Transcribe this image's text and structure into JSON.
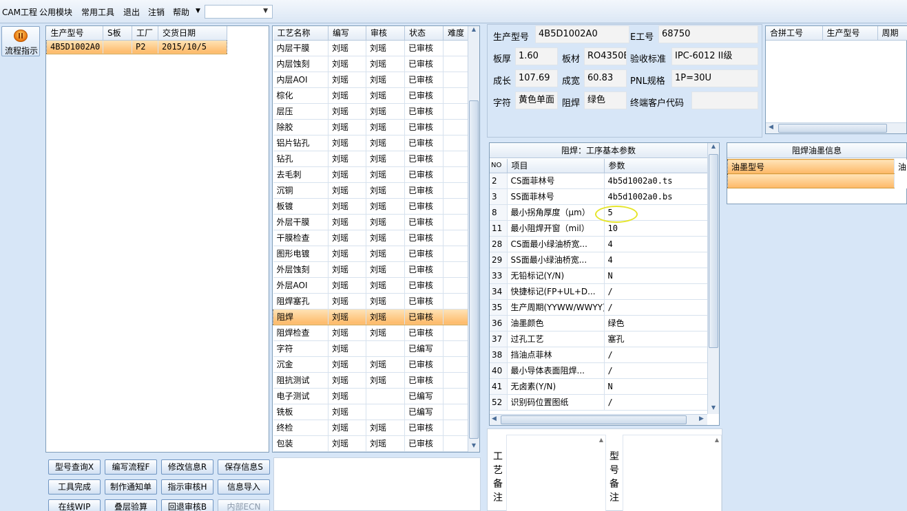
{
  "menu": {
    "items": [
      "CAM工程",
      "公用模块",
      "常用工具",
      "退出",
      "注销",
      "帮助"
    ],
    "dropdown_value": ""
  },
  "sidebar": {
    "flow_label": "流程指示"
  },
  "order_table": {
    "headers": [
      "生产型号",
      "S板",
      "工厂",
      "交货日期"
    ],
    "rows": [
      [
        "4B5D1002A0",
        "",
        "P2",
        "2015/10/5"
      ]
    ]
  },
  "process_table": {
    "headers": [
      "工艺名称",
      "编写",
      "审核",
      "状态",
      "难度"
    ],
    "selected_index": 17,
    "rows": [
      [
        "内层干膜",
        "刘瑶",
        "刘瑶",
        "已审核",
        ""
      ],
      [
        "内层蚀刻",
        "刘瑶",
        "刘瑶",
        "已审核",
        ""
      ],
      [
        "内层AOI",
        "刘瑶",
        "刘瑶",
        "已审核",
        ""
      ],
      [
        "棕化",
        "刘瑶",
        "刘瑶",
        "已审核",
        ""
      ],
      [
        "层压",
        "刘瑶",
        "刘瑶",
        "已审核",
        ""
      ],
      [
        "除胶",
        "刘瑶",
        "刘瑶",
        "已审核",
        ""
      ],
      [
        "铝片钻孔",
        "刘瑶",
        "刘瑶",
        "已审核",
        ""
      ],
      [
        "钻孔",
        "刘瑶",
        "刘瑶",
        "已审核",
        ""
      ],
      [
        "去毛刺",
        "刘瑶",
        "刘瑶",
        "已审核",
        ""
      ],
      [
        "沉铜",
        "刘瑶",
        "刘瑶",
        "已审核",
        ""
      ],
      [
        "板镀",
        "刘瑶",
        "刘瑶",
        "已审核",
        ""
      ],
      [
        "外层干膜",
        "刘瑶",
        "刘瑶",
        "已审核",
        ""
      ],
      [
        "干膜检查",
        "刘瑶",
        "刘瑶",
        "已审核",
        ""
      ],
      [
        "图形电镀",
        "刘瑶",
        "刘瑶",
        "已审核",
        ""
      ],
      [
        "外层蚀刻",
        "刘瑶",
        "刘瑶",
        "已审核",
        ""
      ],
      [
        "外层AOI",
        "刘瑶",
        "刘瑶",
        "已审核",
        ""
      ],
      [
        "阻焊塞孔",
        "刘瑶",
        "刘瑶",
        "已审核",
        ""
      ],
      [
        "阻焊",
        "刘瑶",
        "刘瑶",
        "已审核",
        ""
      ],
      [
        "阻焊检查",
        "刘瑶",
        "刘瑶",
        "已审核",
        ""
      ],
      [
        "字符",
        "刘瑶",
        "",
        "已编写",
        ""
      ],
      [
        "沉金",
        "刘瑶",
        "刘瑶",
        "已审核",
        ""
      ],
      [
        "阻抗测试",
        "刘瑶",
        "刘瑶",
        "已审核",
        ""
      ],
      [
        "电子测试",
        "刘瑶",
        "",
        "已编写",
        ""
      ],
      [
        "铣板",
        "刘瑶",
        "",
        "已编写",
        ""
      ],
      [
        "终检",
        "刘瑶",
        "刘瑶",
        "已审核",
        ""
      ],
      [
        "包装",
        "刘瑶",
        "刘瑶",
        "已审核",
        ""
      ]
    ]
  },
  "buttons": [
    [
      "型号查询X",
      "编写流程F",
      "修改信息R",
      "保存信息S"
    ],
    [
      "工具完成",
      "制作通知单",
      "指示审核H",
      "信息导入"
    ],
    [
      "在线WIP",
      "叠层验算",
      "回退审核B",
      "内部ECN"
    ]
  ],
  "info": {
    "labels": {
      "model": "生产型号",
      "e_no": "E工号",
      "thickness": "板厚",
      "material": "板材",
      "standard": "验收标准",
      "length": "成长",
      "width": "成宽",
      "pnl": "PNL规格",
      "silk": "字符",
      "mask": "阻焊",
      "customer": "终端客户代码"
    },
    "values": {
      "model": "4B5D1002A0",
      "e_no": "68750",
      "thickness": "1.60",
      "material": "RO4350B",
      "standard": "IPC-6012 II级",
      "length": "107.69",
      "width": "60.83",
      "pnl": "1P=30U",
      "silk": "黄色单面",
      "mask": "绿色",
      "customer": ""
    }
  },
  "merge_table": {
    "headers": [
      "合拼工号",
      "生产型号",
      "周期"
    ]
  },
  "params": {
    "title": "阻焊：工序基本参数",
    "headers": [
      "NO",
      "项目",
      "参数"
    ],
    "rows": [
      [
        "2",
        "CS面菲林号",
        "4b5d1002a0.ts"
      ],
      [
        "3",
        "SS面菲林号",
        "4b5d1002a0.bs"
      ],
      [
        "8",
        "最小拐角厚度（μm）",
        "5"
      ],
      [
        "11",
        "最小阻焊开窗（mil）",
        "10"
      ],
      [
        "28",
        "CS面最小绿油桥宽...",
        "4"
      ],
      [
        "29",
        "SS面最小绿油桥宽...",
        "4"
      ],
      [
        "33",
        "无铅标记(Y/N)",
        "N"
      ],
      [
        "34",
        "快捷标记(FP+UL+D...",
        "/"
      ],
      [
        "35",
        "生产周期(YYWW/WWYY)",
        "/"
      ],
      [
        "36",
        "油墨颜色",
        "绿色"
      ],
      [
        "37",
        "过孔工艺",
        "塞孔"
      ],
      [
        "38",
        "挡油点菲林",
        "/"
      ],
      [
        "40",
        "最小导体表面阻焊...",
        "/"
      ],
      [
        "41",
        "无卤素(Y/N)",
        "N"
      ],
      [
        "52",
        "识别码位置图纸",
        "/"
      ]
    ]
  },
  "ink": {
    "title": "阻焊油墨信息",
    "headers": [
      "油墨型号",
      "油"
    ]
  },
  "notes": {
    "process_label": "工艺备注",
    "model_label": "型号备注"
  }
}
